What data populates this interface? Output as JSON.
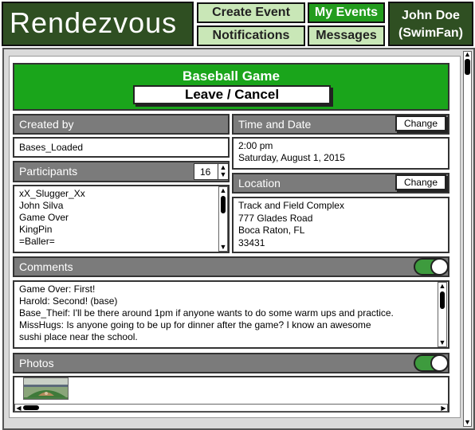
{
  "app": {
    "title": "Rendezvous"
  },
  "nav": {
    "create_event": "Create Event",
    "my_events": "My Events",
    "notifications": "Notifications",
    "messages": "Messages"
  },
  "user": {
    "name": "John Doe",
    "handle": "(SwimFan)"
  },
  "event": {
    "title": "Baseball Game",
    "leave_label": "Leave / Cancel"
  },
  "created_by": {
    "label": "Created by",
    "value": "Bases_Loaded"
  },
  "time_date": {
    "label": "Time and Date",
    "change_label": "Change",
    "time": "2:00 pm",
    "date": "Saturday, August 1, 2015"
  },
  "participants": {
    "label": "Participants",
    "count": "16",
    "names": [
      "xX_Slugger_Xx",
      "John Silva",
      "Game Over",
      "KingPin",
      "=Baller="
    ]
  },
  "location": {
    "label": "Location",
    "change_label": "Change",
    "lines": [
      "Track and Field Complex",
      "777 Glades Road",
      "Boca Raton, FL",
      "33431"
    ]
  },
  "comments": {
    "label": "Comments",
    "enabled": true,
    "items": [
      "Game Over: First!",
      "Harold: Second! (base)",
      "Base_Theif: I'll be there around 1pm if anyone wants to do some warm ups and practice.",
      "MissHugs: Is anyone going to be up for dinner after the game?  I know an awesome",
      "sushi place near the school."
    ]
  },
  "photos": {
    "label": "Photos",
    "enabled": true,
    "count": 1
  },
  "colors": {
    "brand_dark": "#2f4f22",
    "accent_green": "#1aa51b",
    "nav_light": "#c9e7b7",
    "section_gray": "#7b7b7b"
  }
}
